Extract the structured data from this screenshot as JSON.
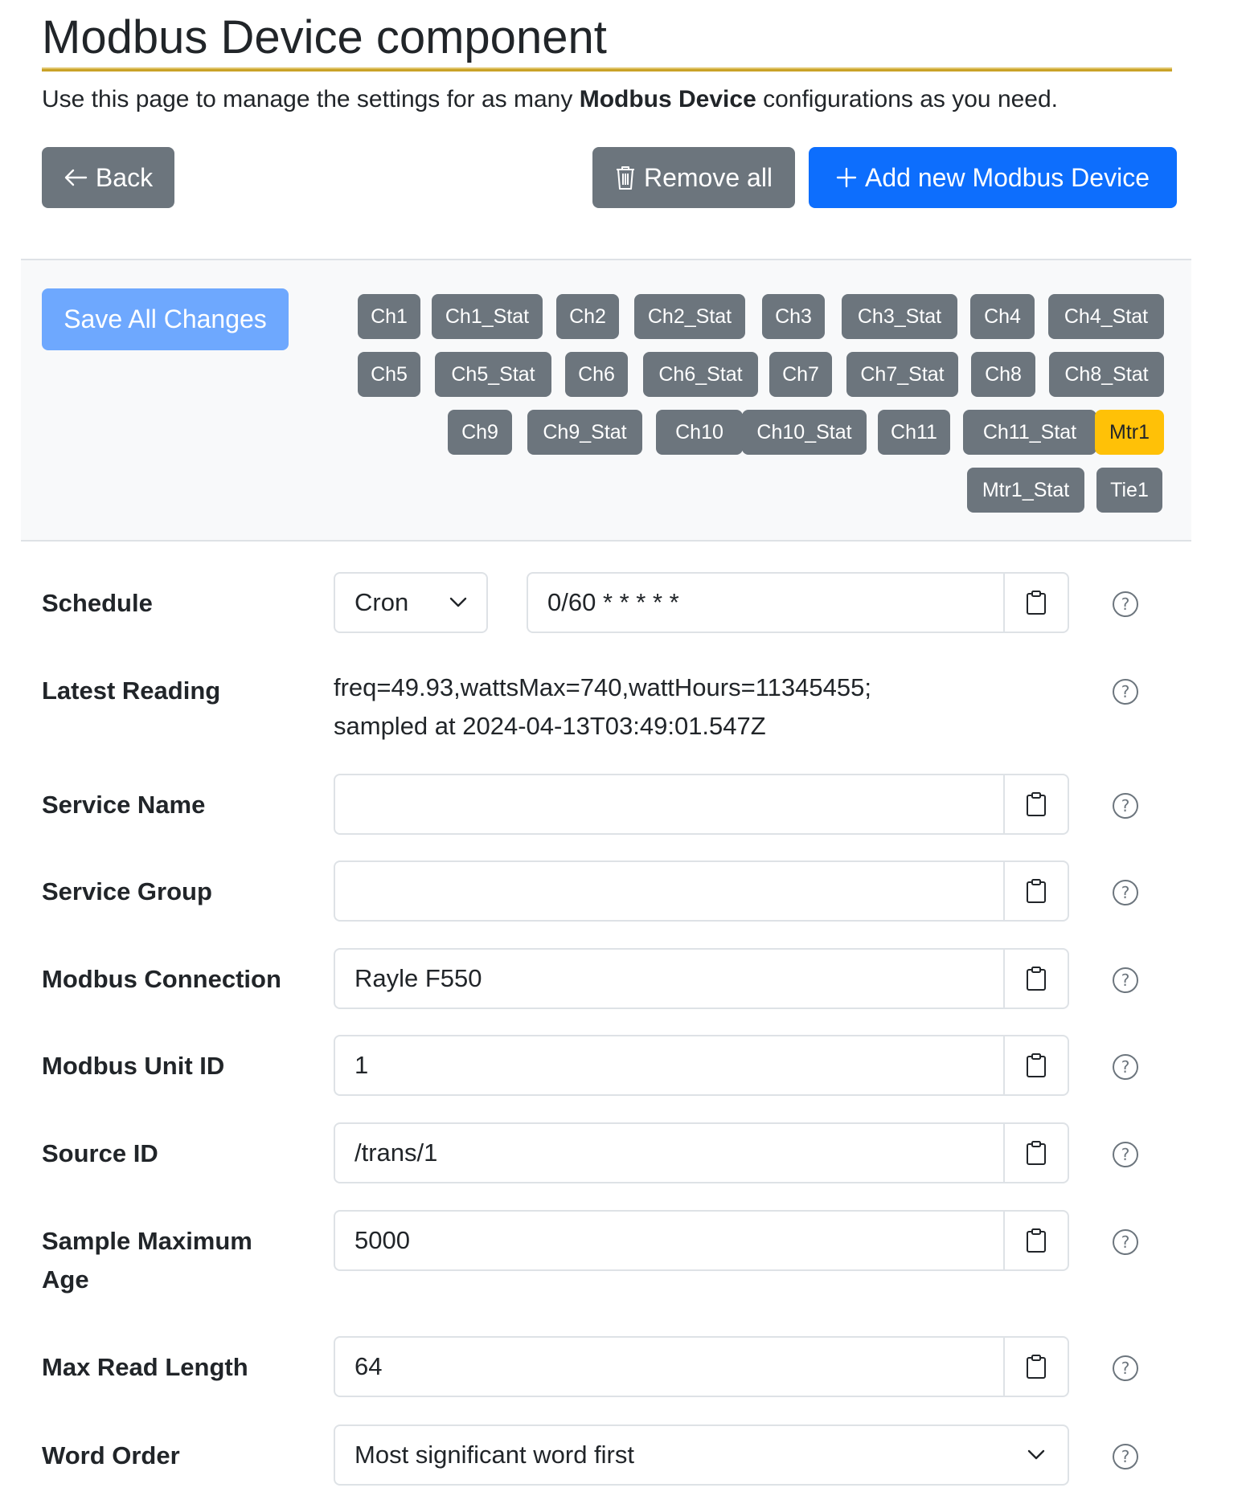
{
  "page": {
    "title": "Modbus Device component",
    "intro_prefix": "Use this page to manage the settings for as many ",
    "intro_bold": "Modbus Device",
    "intro_suffix": " configurations as you need."
  },
  "actions": {
    "back_label": "Back",
    "remove_all_label": "Remove all",
    "add_label": "Add new Modbus Device",
    "save_label": "Save All Changes"
  },
  "chips": [
    "Ch1",
    "Ch1_Stat",
    "Ch2",
    "Ch2_Stat",
    "Ch3",
    "Ch3_Stat",
    "Ch4",
    "Ch4_Stat",
    "Ch5",
    "Ch5_Stat",
    "Ch6",
    "Ch6_Stat",
    "Ch7",
    "Ch7_Stat",
    "Ch8",
    "Ch8_Stat",
    "Ch9",
    "Ch9_Stat",
    "Ch10",
    "Ch10_Stat",
    "Ch11",
    "Ch11_Stat",
    "Mtr1",
    "Mtr1_Stat",
    "Tie1"
  ],
  "active_chip": "Mtr1",
  "form": {
    "schedule": {
      "label": "Schedule",
      "type_value": "Cron",
      "value": "0/60 * * * * *"
    },
    "latest_reading": {
      "label": "Latest Reading",
      "line1": "freq=49.93,wattsMax=740,wattHours=11345455;",
      "line2": "sampled at 2024-04-13T03:49:01.547Z"
    },
    "service_name": {
      "label": "Service Name",
      "value": ""
    },
    "service_group": {
      "label": "Service Group",
      "value": ""
    },
    "modbus_connection": {
      "label": "Modbus Connection",
      "value": "Rayle F550"
    },
    "modbus_unit_id": {
      "label": "Modbus Unit ID",
      "value": "1"
    },
    "source_id": {
      "label": "Source ID",
      "value": "/trans/1"
    },
    "sample_max_age": {
      "label_line1": "Sample Maximum",
      "label_line2": "Age",
      "value": "5000"
    },
    "max_read_length": {
      "label": "Max Read Length",
      "value": "64"
    },
    "word_order": {
      "label": "Word Order",
      "value": "Most significant word first"
    }
  },
  "colors": {
    "primary": "#0d6efd",
    "secondary": "#6c757d",
    "warning": "#ffc107",
    "title_rule": "#c9a227"
  },
  "icons": [
    "arrow-left-icon",
    "trash-icon",
    "plus-icon",
    "clipboard-icon",
    "question-circle-icon",
    "chevron-down-icon"
  ]
}
